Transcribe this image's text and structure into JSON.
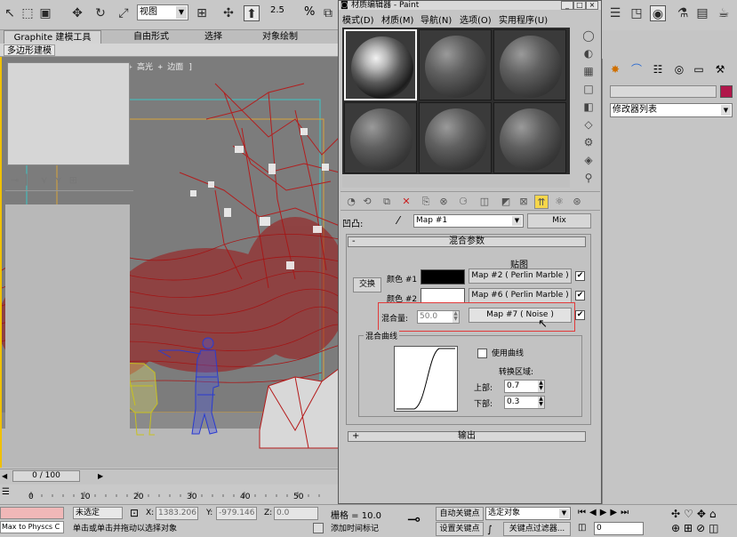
{
  "toolbar": {
    "view_select": "视图",
    "snap_percent": "2.5",
    "angle_label": "%"
  },
  "ribbon": {
    "tabs": [
      "Graphite 建模工具",
      "自由形式",
      "选择",
      "对象绘制"
    ],
    "sub_tab": "多边形建模"
  },
  "viewport": {
    "label": "[ + ] [ Camera01 ] [ 平滑 + 高光 + 边面 ]"
  },
  "timeline": {
    "frame_display": "0 / 100",
    "ticks": [
      "0",
      "10",
      "20",
      "30",
      "40",
      "50"
    ]
  },
  "status": {
    "script_field": "Max to Physcs C",
    "selection_state": "未选定",
    "x_label": "X:",
    "x_value": "1383.206",
    "y_label": "Y:",
    "y_value": "-979.146",
    "z_label": "Z:",
    "z_value": "0.0",
    "grid": "栅格 = 10.0",
    "auto_key": "自动关键点",
    "set_key": "设置关键点",
    "key_mode_select": "选定对象",
    "key_filters": "关键点过滤器...",
    "add_time_tag": "添加时间标记",
    "prompt": "单击或单击并拖动以选择对象",
    "frame_value": "0"
  },
  "material_editor": {
    "title": "材质编辑器 - Paint",
    "menu": [
      "模式(D)",
      "材质(M)",
      "导航(N)",
      "选项(O)",
      "实用程序(U)"
    ],
    "bump_label": "凹凸:",
    "map_name": "Map #1",
    "map_type": "Mix",
    "mix_params": {
      "header": "混合参数",
      "maps_label": "贴图",
      "swap_button": "交换",
      "color1_label": "颜色 #1",
      "color2_label": "颜色 #2",
      "color1_map": "Map #2 ( Perlin Marble )",
      "color2_map": "Map #6 ( Perlin Marble )",
      "mix_amount_label": "混合量:",
      "mix_amount_value": "50.0",
      "mix_amount_map": "Map #7 ( Noise )"
    },
    "mix_curve": {
      "header": "混合曲线",
      "use_curve_label": "使用曲线",
      "transition_label": "转换区域:",
      "upper_label": "上部:",
      "upper_value": "0.7",
      "lower_label": "下部:",
      "lower_value": "0.3"
    },
    "output_header": "输出"
  },
  "command_panel": {
    "modifier_list": "修改器列表",
    "name_value": ""
  },
  "colors": {
    "accent_red": "#e23a3a",
    "viewport_bg": "#7c7c7c",
    "tree_red": "#b51a1a",
    "cow_yellow": "#c9c21f",
    "person_blue": "#2a3bd0",
    "active_border": "#f0c000"
  }
}
